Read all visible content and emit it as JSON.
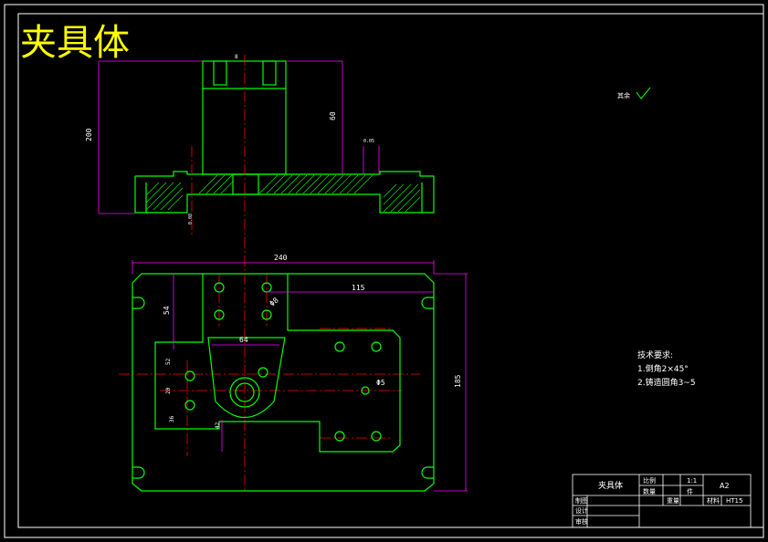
{
  "drawing": {
    "title": "夹具体",
    "scale": "1:1",
    "sheet_size": "A2",
    "material": "HT15"
  },
  "dimensions": {
    "top_height": "200",
    "upper_bore": "60",
    "small_label": "8",
    "width": "240",
    "hole_offset": "115",
    "upper_left": "54",
    "center_width": "64",
    "dia_small": "Φ8",
    "dia_right": "Φ5",
    "height_right": "185",
    "left_small_1": "52",
    "left_small_2": "20",
    "left_small_3": "36",
    "bottom_small": "42",
    "tiny_1": "0.05",
    "tiny_2": "0.08"
  },
  "surface_note": "其余",
  "tech_notes": {
    "heading": "技术要求:",
    "line1": "1.倒角2×45°",
    "line2": "2.铸造圆角3~5"
  },
  "title_block": {
    "part_name": "夹具体",
    "scale_label": "比例",
    "scale_value": "1:1",
    "count_label": "数量",
    "count_value": "件",
    "sheet": "A2",
    "material_label": "材料",
    "material_value": "HT15",
    "weight_label": "重量",
    "row_draw": "制图",
    "row_design": "设计",
    "row_check": "审核"
  },
  "colors": {
    "outline": "#00ff00",
    "centerline": "#ff0000",
    "dimension": "#ff00ff",
    "text": "#ffffff",
    "title": "#ffff00",
    "hatch": "#00ff00"
  }
}
